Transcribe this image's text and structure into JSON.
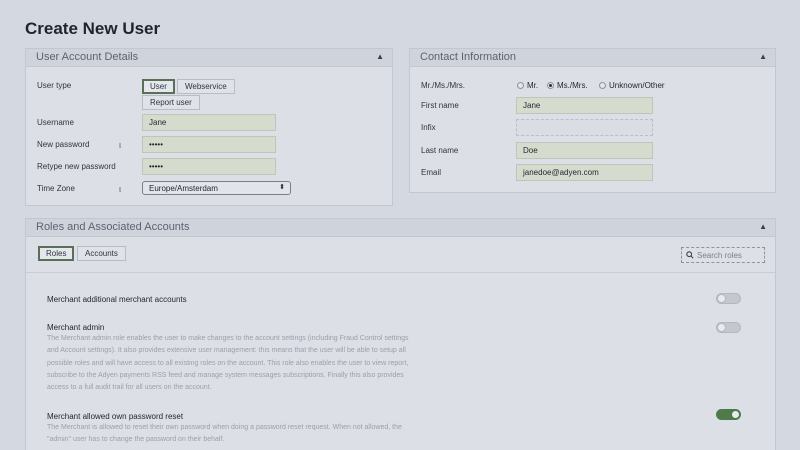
{
  "page": {
    "title": "Create New User"
  },
  "account": {
    "heading": "User Account Details",
    "user_type_label": "User type",
    "user_types": [
      "User",
      "Webservice",
      "Report user"
    ],
    "selected_type": "User",
    "username_label": "Username",
    "username_value": "Jane",
    "new_password_label": "New password",
    "new_password_value": "•••••",
    "retype_password_label": "Retype new password",
    "retype_password_value": "•••••",
    "timezone_label": "Time Zone",
    "timezone_value": "Europe/Amsterdam",
    "info_icon_glyph": "ι"
  },
  "contact": {
    "heading": "Contact Information",
    "salutation_label": "Mr./Ms./Mrs.",
    "salutation_options": [
      "Mr.",
      "Ms./Mrs.",
      "Unknown/Other"
    ],
    "salutation_selected": "Ms./Mrs.",
    "first_name_label": "First name",
    "first_name_value": "Jane",
    "infix_label": "Infix",
    "infix_value": "",
    "last_name_label": "Last name",
    "last_name_value": "Doe",
    "email_label": "Email",
    "email_value": "janedoe@adyen.com"
  },
  "roles": {
    "heading": "Roles and Associated Accounts",
    "tabs": [
      "Roles",
      "Accounts"
    ],
    "active_tab": "Roles",
    "search_placeholder": "Search roles",
    "items": [
      {
        "title": "Merchant additional merchant accounts",
        "description": "",
        "enabled": false
      },
      {
        "title": "Merchant admin",
        "description_lines": [
          "The Merchant admin role enables the user to make changes to the account settings (including Fraud Control settings",
          "and Account settings). It also provides extensive user management: this means that the user will be able to setup all",
          "possible roles and will have access to all existing roles on the account. This role also enables the user to view report,",
          "subscribe to the Adyen payments RSS feed and manage system messages subscriptions. Finally this also provides",
          "access to a full audit trail for all users on the account."
        ],
        "enabled": false
      },
      {
        "title": "Merchant allowed own password reset",
        "description_lines": [
          "The Merchant is allowed to reset their own password when doing a password reset request. When not allowed, the",
          "\"admin\" user has to change the password on their behalf."
        ],
        "enabled": true
      }
    ]
  },
  "colors": {
    "toggle_on": "#4f7a4a",
    "field_bg": "#d6dccd"
  },
  "icons": {
    "collapse": "caret-up-icon",
    "search": "search-icon",
    "info": "info-icon"
  }
}
